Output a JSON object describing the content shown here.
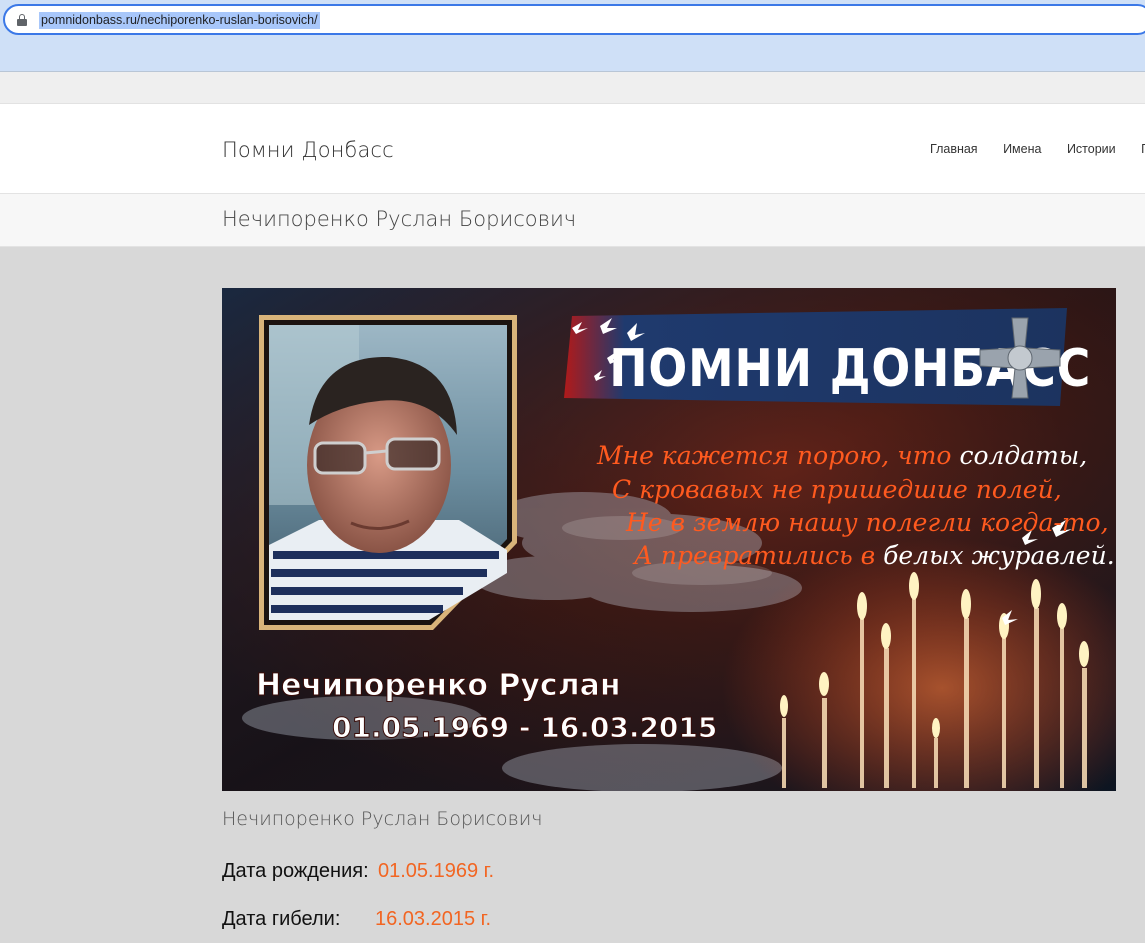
{
  "browser": {
    "url": "pomnidonbass.ru/nechiporenko-ruslan-borisovich/"
  },
  "site": {
    "brand": "Помни Донбасс",
    "nav": [
      "Главная",
      "Имена",
      "Истории",
      "П"
    ]
  },
  "page": {
    "title": "Нечипоренко Руслан Борисович"
  },
  "banner": {
    "logo_text": "ПОМНИ ДОНБАСС",
    "poem": [
      [
        "Мне кажется порою, что ",
        "солдаты,"
      ],
      [
        "С кровавых не пришедшие полей,",
        ""
      ],
      [
        "Не в землю нашу полегли когда-то,",
        ""
      ],
      [
        "А превратились в ",
        "белых журавлей..."
      ]
    ],
    "name": "Нечипоренко Руслан",
    "dates": "01.05.1969 - 16.03.2015",
    "colors": {
      "logo_band": "#1f3a6e",
      "poem_accent": "#ff5a1f",
      "poem_white": "#ffffff"
    }
  },
  "content": {
    "caption": "Нечипоренко Руслан Борисович",
    "birth_label": "Дата рождения:",
    "birth_value": "01.05.1969 г.",
    "death_label": "Дата гибели:",
    "death_value": "16.03.2015 г.",
    "value_color": "#f26522"
  }
}
